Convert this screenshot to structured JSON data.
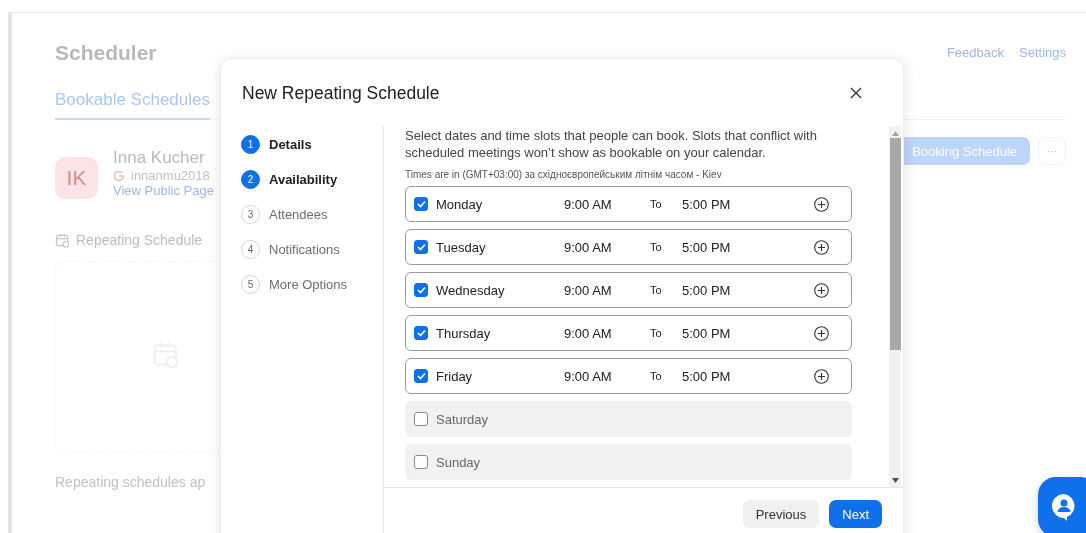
{
  "page": {
    "title": "Scheduler",
    "links": [
      "Feedback",
      "Settings"
    ],
    "tabs": [
      {
        "label": "Bookable Schedules",
        "selected": true
      }
    ],
    "profile": {
      "initials": "IK",
      "name": "Inna Kucher",
      "email": "innanmu2018",
      "link": "View Public Page"
    },
    "primary_button": "Booking Schedule",
    "more_button": "···",
    "section_title": "Repeating Schedule",
    "footer_text": "Repeating schedules ap"
  },
  "dialog": {
    "title": "New Repeating Schedule",
    "steps": [
      {
        "number": "1",
        "label": "Details",
        "done": true
      },
      {
        "number": "2",
        "label": "Availability",
        "done": true
      },
      {
        "number": "3",
        "label": "Attendees",
        "done": false
      },
      {
        "number": "4",
        "label": "Notifications",
        "done": false
      },
      {
        "number": "5",
        "label": "More Options",
        "done": false
      }
    ],
    "description": "Select dates and time slots that people can book. Slots that conflict with scheduled meetings won’t show as bookable on your calendar.",
    "timezone": "Times are in (GMT+03:00) за східноєвропейським літнім часом - Kiev",
    "days": [
      {
        "name": "Monday",
        "checked": true,
        "start": "9:00 AM",
        "separator": "To",
        "end": "5:00 PM"
      },
      {
        "name": "Tuesday",
        "checked": true,
        "start": "9:00 AM",
        "separator": "To",
        "end": "5:00 PM"
      },
      {
        "name": "Wednesday",
        "checked": true,
        "start": "9:00 AM",
        "separator": "To",
        "end": "5:00 PM"
      },
      {
        "name": "Thursday",
        "checked": true,
        "start": "9:00 AM",
        "separator": "To",
        "end": "5:00 PM"
      },
      {
        "name": "Friday",
        "checked": true,
        "start": "9:00 AM",
        "separator": "To",
        "end": "5:00 PM"
      },
      {
        "name": "Saturday",
        "checked": false
      },
      {
        "name": "Sunday",
        "checked": false
      }
    ],
    "buttons": [
      "Previous",
      "Next"
    ]
  }
}
